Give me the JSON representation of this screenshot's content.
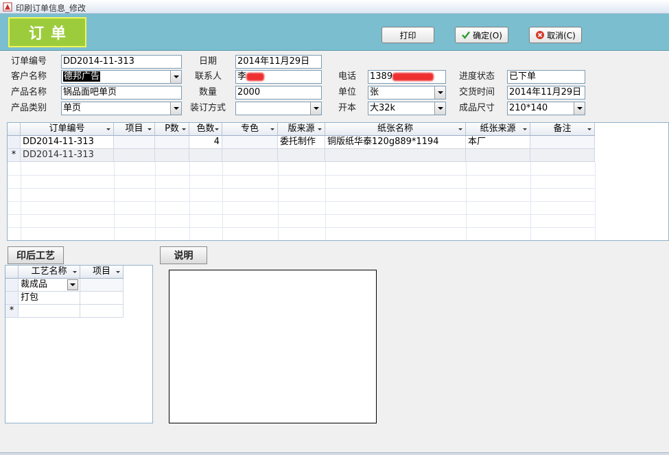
{
  "window": {
    "title": "印刷订单信息_修改"
  },
  "header": {
    "title": "订单",
    "print_label": "打印",
    "ok_label": "确定(O)",
    "cancel_label": "取消(C)"
  },
  "form": {
    "order_no_label": "订单编号",
    "order_no": "DD2014-11-313",
    "date_label": "日期",
    "date": "2014年11月29日",
    "customer_label": "客户名称",
    "customer": "德邦广告",
    "contact_label": "联系人",
    "contact": "李",
    "phone_label": "电话",
    "phone": "1389",
    "status_label": "进度状态",
    "status": "已下单",
    "product_label": "产品名称",
    "product": "锅品面吧单页",
    "qty_label": "数量",
    "qty": "2000",
    "unit_label": "单位",
    "unit": "张",
    "delivery_label": "交货时间",
    "delivery": "2014年11月29日",
    "category_label": "产品类别",
    "category": "单页",
    "binding_label": "装订方式",
    "binding": "",
    "format_label": "开本",
    "format": "大32k",
    "size_label": "成品尺寸",
    "size": "210*140"
  },
  "detail_grid": {
    "columns": [
      "订单编号",
      "项目",
      "P数",
      "色数",
      "专色",
      "版来源",
      "纸张名称",
      "纸张来源",
      "备注"
    ],
    "rows": [
      [
        "DD2014-11-313",
        "",
        "",
        "4",
        "",
        "委托制作",
        "铜版纸华泰120g889*1194",
        "本厂",
        ""
      ],
      [
        "DD2014-11-313",
        "",
        "",
        "",
        "",
        "",
        "",
        "",
        ""
      ]
    ],
    "new_row_marker": "*"
  },
  "process": {
    "button_label": "印后工艺",
    "columns": [
      "工艺名称",
      "项目"
    ],
    "rows": [
      [
        "裁成品",
        ""
      ],
      [
        "打包",
        ""
      ]
    ],
    "new_row_marker": "*"
  },
  "notes": {
    "button_label": "说明"
  },
  "colors": {
    "header_bg": "#7abecf",
    "title_bg": "#9ccc3c",
    "title_border": "#f1f65b"
  }
}
